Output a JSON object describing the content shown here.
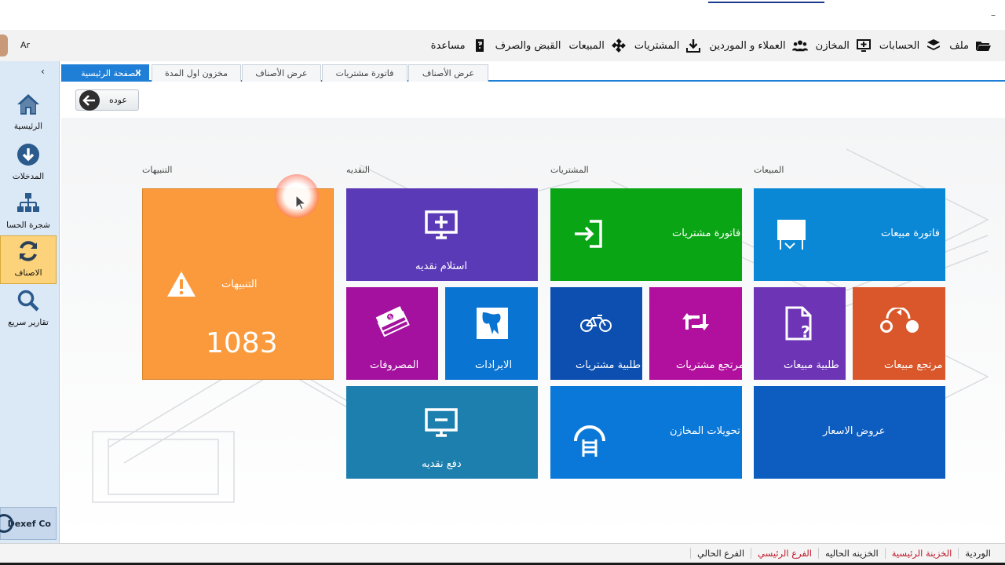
{
  "top": {
    "minimize": "–"
  },
  "menubar": {
    "lang": "Ar",
    "items": [
      {
        "label": "ملف",
        "icon": "folder-open-icon"
      },
      {
        "label": "الحسابات",
        "icon": "layers-icon"
      },
      {
        "label": "المخازن",
        "icon": "monitor-plus-icon"
      },
      {
        "label": "العملاء و الموردين",
        "icon": "users-icon"
      },
      {
        "label": "المشتريات",
        "icon": "download-icon"
      },
      {
        "label": "المبيعات",
        "icon": "puzzle-icon"
      },
      {
        "label": "القبض والصرف",
        "icon": ""
      },
      {
        "label": "مساعدة",
        "icon": "help-book-icon"
      }
    ]
  },
  "sidebar": {
    "collapse": "‹",
    "items": [
      {
        "label": "الرئيسية",
        "icon": "home-icon"
      },
      {
        "label": "المدخلات",
        "icon": "arrow-down-circle-icon"
      },
      {
        "label": "شجرة الحسا",
        "icon": "sitemap-icon"
      },
      {
        "label": "الاصناف",
        "icon": "refresh-icon"
      },
      {
        "label": "تقارير سريع",
        "icon": "search-icon"
      }
    ],
    "brand": "Dexef Co"
  },
  "tabs": [
    {
      "label": "الصفحة الرئيسية",
      "active": true
    },
    {
      "label": "مخزون اول المدة"
    },
    {
      "label": "عرض الأصناف"
    },
    {
      "label": "فاتورة مشتريات"
    },
    {
      "label": "عرض الأصناف"
    }
  ],
  "back_button": "عوده",
  "sections": {
    "alerts": "التنبيهات",
    "cash": "النقديه",
    "purchases": "المشتريات",
    "sales": "المبيعات"
  },
  "tiles": {
    "alerts": {
      "label": "التنبيهات",
      "count": "1083",
      "color": "#fb9a3c"
    },
    "cash_receive": {
      "label": "استلام نقديه",
      "color": "#5b3ab8"
    },
    "expenses": {
      "label": "المصروفات",
      "color": "#a4119e"
    },
    "revenues": {
      "label": "الايرادات",
      "color": "#0a74d3"
    },
    "cash_pay": {
      "label": "دفع نقديه",
      "color": "#1c7fae"
    },
    "purchase_invoice": {
      "label": "فاتورة مشتريات",
      "color": "#0aa514"
    },
    "purchase_order": {
      "label": "طلبية مشتريات",
      "color": "#0c4fb1"
    },
    "purchase_return": {
      "label": "مرتجع مشتريات",
      "color": "#b1109e"
    },
    "warehouse_transfers": {
      "label": "تحويلات المخازن",
      "color": "#0a78d8"
    },
    "sales_invoice": {
      "label": "فاتورة مبيعات",
      "color": "#0a88d6"
    },
    "sales_order": {
      "label": "طلبية مبيعات",
      "color": "#6d35b6"
    },
    "sales_return": {
      "label": "مرتجع مبيعات",
      "color": "#d9572a"
    },
    "price_quotes": {
      "label": "عروض الاسعار",
      "color": "#0d5cc0"
    }
  },
  "statusbar": {
    "items": [
      {
        "label": "الوردية",
        "red": false
      },
      {
        "label": "الخزينة الرئيسية",
        "red": true
      },
      {
        "label": "الخزينه الحاليه",
        "red": false
      },
      {
        "label": "الفرع الرئيسي",
        "red": true
      },
      {
        "label": "الفرع الحالي",
        "red": false
      }
    ]
  }
}
